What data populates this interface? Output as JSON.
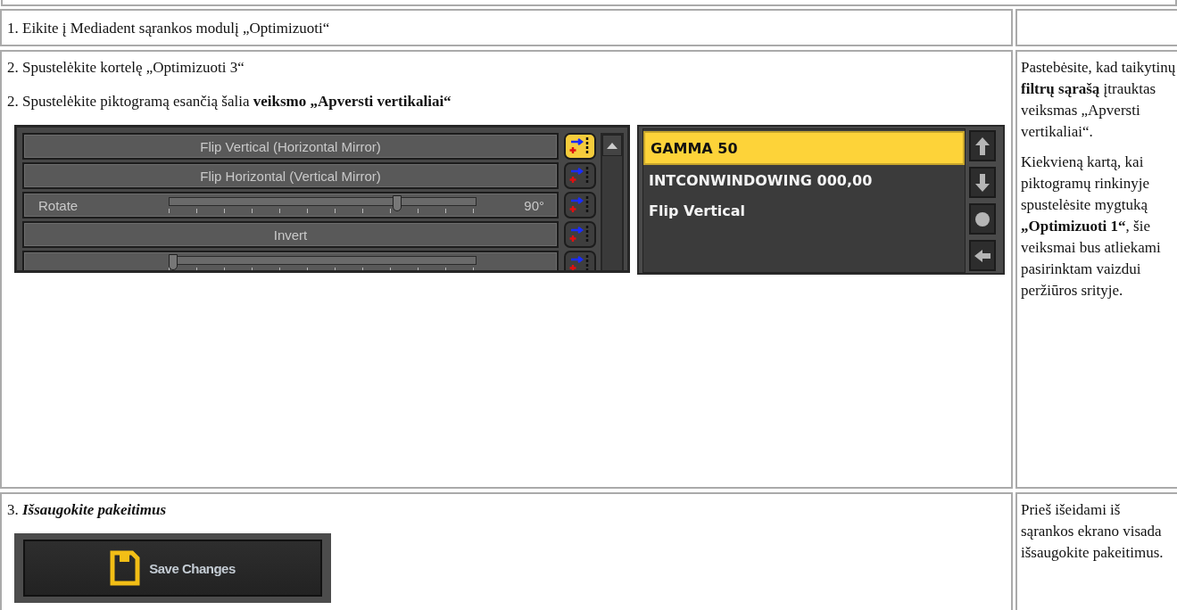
{
  "rows": [
    {
      "paragraphs": [
        {
          "kind": "text",
          "text": "1. Eikite į Mediadent sąrankos modulį „Optimizuoti“"
        }
      ]
    },
    {
      "paragraphs": [
        {
          "kind": "text",
          "text": "2. Spustelėkite kortelę „Optimizuoti 3“"
        },
        {
          "kind": "text",
          "text": "2. Spustelėkite piktogramą esančią šalia **veiksmo „Apversti vertikaliai“**"
        }
      ],
      "figure": {
        "kind": "filter_screens",
        "filters": [
          {
            "kind": "button",
            "label": "Flip Vertical (Horizontal Mirror)",
            "selected": true
          },
          {
            "kind": "button",
            "label": "Flip Horizontal (Vertical Mirror)",
            "selected": false
          },
          {
            "kind": "slider",
            "label": "Rotate",
            "level": 0.75,
            "reading": "90°",
            "selected": false
          },
          {
            "kind": "button",
            "label": "Invert",
            "selected": false
          },
          {
            "kind": "slider",
            "level": 0,
            "selected": false
          }
        ],
        "actions": [
          {
            "label": "GAMMA 50",
            "selected": true
          },
          {
            "label": "INTCONWINDOWING 000,00",
            "selected": false
          },
          {
            "label": "Flip Vertical",
            "selected": false
          }
        ]
      },
      "note": [
        "Pastebėsite, kad taikytinų **filtrų sąrašą** įtrauktas veiksmas „Apversti vertikaliai“.",
        "Kiekvieną kartą, kai piktogramų rinkinyje spustelėsite mygtuką **„Optimizuoti 1“**, šie veiksmai bus atliekami pasirinktam vaizdui peržiūros srityje."
      ]
    },
    {
      "paragraphs": [
        {
          "kind": "step_title",
          "number": "3.",
          "title": "Išsaugokite pakeitimus"
        }
      ],
      "figure": {
        "kind": "save_button",
        "label": "Save Changes"
      },
      "note": [
        "Prieš išeidami iš sąrankos ekrano visada išsaugokite pakeitimus."
      ]
    }
  ]
}
